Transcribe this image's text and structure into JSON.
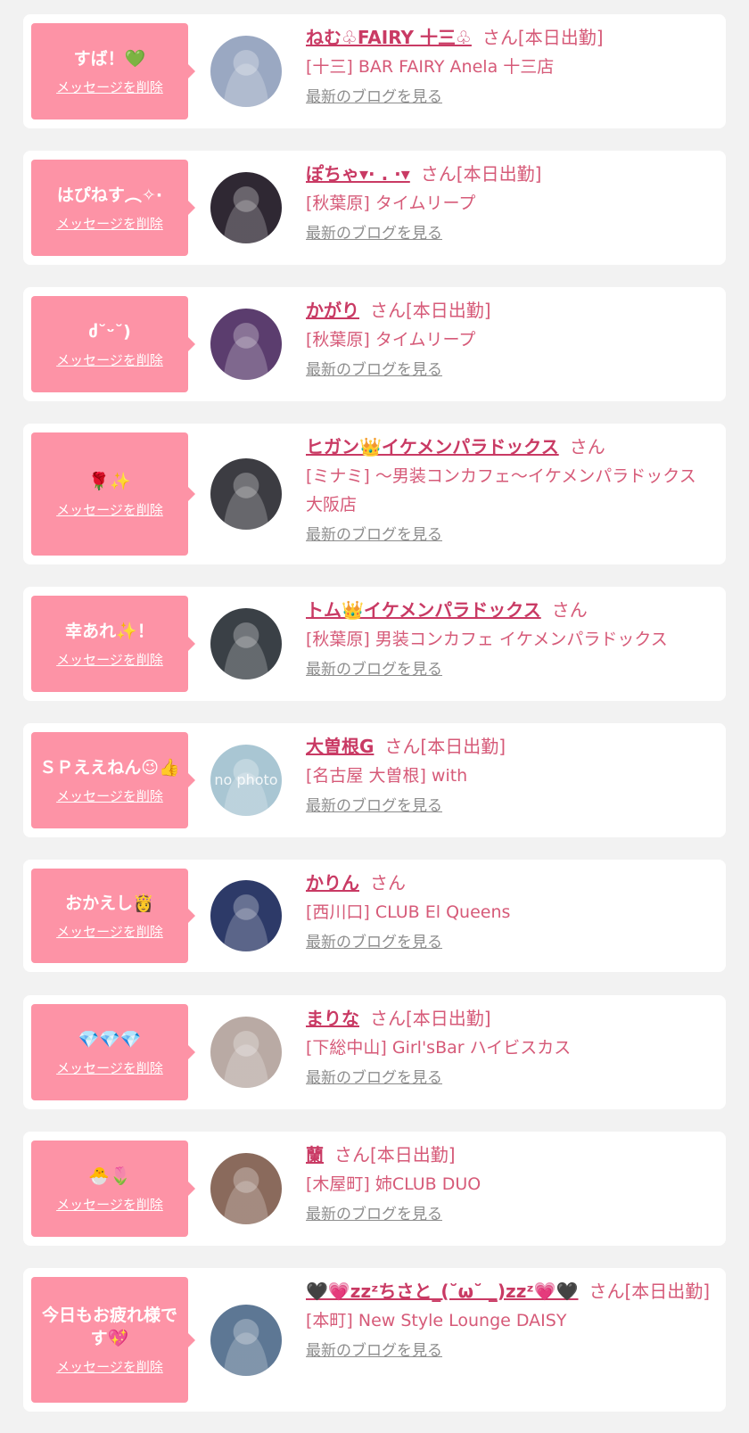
{
  "entries": [
    {
      "message": "すば！💚",
      "delete_label": "メッセージを削除",
      "name": "ねむ♧FAIRY 十三♧",
      "san": "さん",
      "status": "[本日出勤]",
      "shop": "[十三] BAR FAIRY Anela 十三店",
      "blog_label": "最新のブログを見る",
      "avatar_color": "#9aa8c2"
    },
    {
      "message": "はぴねす︵✧·",
      "delete_label": "メッセージを削除",
      "name": "ぽちゃ▾· . ·▾",
      "san": "さん",
      "status": "[本日出勤]",
      "shop": "[秋葉原] タイムリープ",
      "blog_label": "最新のブログを見る",
      "avatar_color": "#2f2833"
    },
    {
      "message": "ძ˘ᵕ˘)",
      "delete_label": "メッセージを削除",
      "name": "かがり",
      "san": "さん",
      "status": "[本日出勤]",
      "shop": "[秋葉原] タイムリープ",
      "blog_label": "最新のブログを見る",
      "avatar_color": "#5b3d6e"
    },
    {
      "message": "🌹✨",
      "delete_label": "メッセージを削除",
      "name": "ヒガン👑イケメンパラドックス",
      "san": "さん",
      "status": "",
      "shop": "[ミナミ] 〜男装コンカフェ〜イケメンパラドックス大阪店",
      "blog_label": "最新のブログを見る",
      "avatar_color": "#3c3c42"
    },
    {
      "message": "幸あれ✨！",
      "delete_label": "メッセージを削除",
      "name": "トム👑イケメンパラドックス",
      "san": "さん",
      "status": "",
      "shop": "[秋葉原] 男装コンカフェ イケメンパラドックス",
      "blog_label": "最新のブログを見る",
      "avatar_color": "#3a4046"
    },
    {
      "message": "ＳＰええねん😉👍",
      "delete_label": "メッセージを削除",
      "name": "大曽根G",
      "san": "さん",
      "status": "[本日出勤]",
      "shop": "[名古屋 大曽根] with",
      "blog_label": "最新のブログを見る",
      "avatar_color": "#a9c6d3",
      "avatar_text": "no photo"
    },
    {
      "message": "おかえし👸",
      "delete_label": "メッセージを削除",
      "name": "かりん",
      "san": "さん",
      "status": "",
      "shop": "[西川口] CLUB El Queens",
      "blog_label": "最新のブログを見る",
      "avatar_color": "#2d3a68"
    },
    {
      "message": "💎💎💎",
      "delete_label": "メッセージを削除",
      "name": "まりな",
      "san": "さん",
      "status": "[本日出勤]",
      "shop": "[下総中山] Girl'sBar ハイビスカス",
      "blog_label": "最新のブログを見る",
      "avatar_color": "#b9aaa4"
    },
    {
      "message": "🐣🌷",
      "delete_label": "メッセージを削除",
      "name": "蘭",
      "san": "さん",
      "status": "[本日出勤]",
      "shop": "[木屋町] 姉CLUB DUO",
      "blog_label": "最新のブログを見る",
      "avatar_color": "#8a6a5c"
    },
    {
      "message": "今日もお疲れ様です💖",
      "delete_label": "メッセージを削除",
      "name": "🖤💗zzᶻちさと_(˘ω˘ _)zzᶻ💗🖤",
      "san": "さん",
      "status": "[本日出勤]",
      "shop": "[本町] New Style Lounge DAISY",
      "blog_label": "最新のブログを見る",
      "avatar_color": "#5d7794"
    }
  ]
}
